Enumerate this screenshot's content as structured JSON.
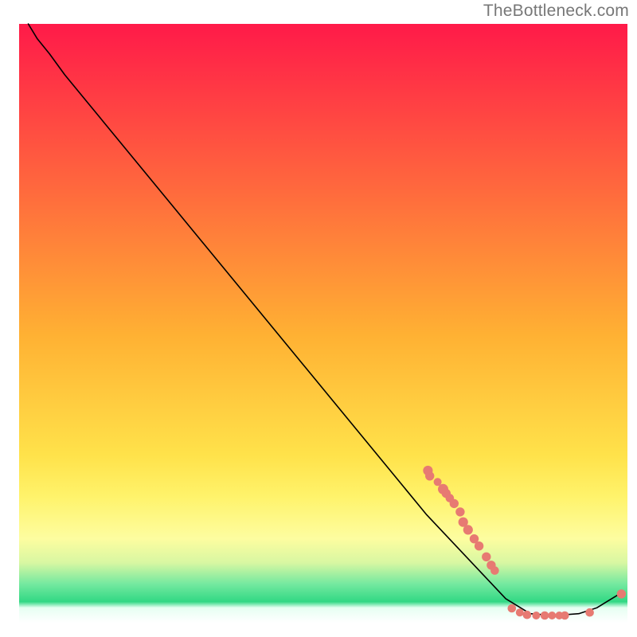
{
  "attribution": "TheBottleneck.com",
  "chart_data": {
    "type": "line",
    "title": "",
    "xlabel": "",
    "ylabel": "",
    "xlim": [
      0,
      100
    ],
    "ylim": [
      0,
      100
    ],
    "background_gradient": {
      "top": "#ff1a49",
      "mid": "#ffc733",
      "lower": "#fff36b",
      "bottom_band": "#39e28a",
      "very_bottom": "#ffffff"
    },
    "curve": [
      {
        "x": 1.5,
        "y": 100
      },
      {
        "x": 3.0,
        "y": 97.5
      },
      {
        "x": 5.0,
        "y": 95.0
      },
      {
        "x": 7.5,
        "y": 91.5
      },
      {
        "x": 67.0,
        "y": 18.0
      },
      {
        "x": 80.0,
        "y": 4.0
      },
      {
        "x": 84.0,
        "y": 1.5
      },
      {
        "x": 88.0,
        "y": 1.2
      },
      {
        "x": 92.0,
        "y": 1.5
      },
      {
        "x": 95.0,
        "y": 2.5
      },
      {
        "x": 99.0,
        "y": 5.0
      }
    ],
    "markers": [
      {
        "x": 67.2,
        "y": 25.4,
        "r": 1.6
      },
      {
        "x": 67.5,
        "y": 24.5,
        "r": 1.5
      },
      {
        "x": 68.8,
        "y": 23.5,
        "r": 1.3
      },
      {
        "x": 69.7,
        "y": 22.3,
        "r": 1.7
      },
      {
        "x": 70.2,
        "y": 21.6,
        "r": 1.5
      },
      {
        "x": 70.8,
        "y": 20.8,
        "r": 1.4
      },
      {
        "x": 71.5,
        "y": 19.9,
        "r": 1.5
      },
      {
        "x": 72.5,
        "y": 18.5,
        "r": 1.5
      },
      {
        "x": 73.0,
        "y": 16.8,
        "r": 1.6
      },
      {
        "x": 73.8,
        "y": 15.5,
        "r": 1.6
      },
      {
        "x": 74.8,
        "y": 14.0,
        "r": 1.5
      },
      {
        "x": 75.6,
        "y": 12.8,
        "r": 1.5
      },
      {
        "x": 76.8,
        "y": 11.0,
        "r": 1.5
      },
      {
        "x": 77.6,
        "y": 9.6,
        "r": 1.5
      },
      {
        "x": 78.2,
        "y": 8.7,
        "r": 1.4
      },
      {
        "x": 81.0,
        "y": 2.4,
        "r": 1.4
      },
      {
        "x": 82.3,
        "y": 1.7,
        "r": 1.3
      },
      {
        "x": 83.5,
        "y": 1.3,
        "r": 1.4
      },
      {
        "x": 85.0,
        "y": 1.2,
        "r": 1.3
      },
      {
        "x": 86.4,
        "y": 1.2,
        "r": 1.4
      },
      {
        "x": 87.6,
        "y": 1.2,
        "r": 1.3
      },
      {
        "x": 88.8,
        "y": 1.2,
        "r": 1.3
      },
      {
        "x": 89.7,
        "y": 1.2,
        "r": 1.4
      },
      {
        "x": 93.8,
        "y": 1.7,
        "r": 1.4
      },
      {
        "x": 99.0,
        "y": 4.8,
        "r": 1.5
      }
    ]
  }
}
